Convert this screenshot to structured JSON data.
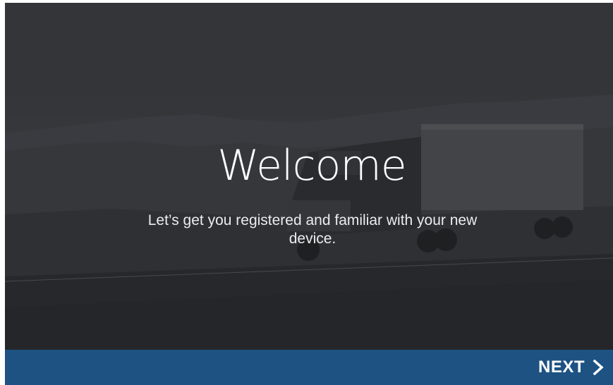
{
  "welcome": {
    "title": "Welcome",
    "subtitle": "Let’s get you registered and familiar with your new device."
  },
  "footer": {
    "next_label": "NEXT",
    "next_icon": "chevron-right-icon"
  },
  "colors": {
    "footer_bg": "#1d5282",
    "text": "#ffffff"
  }
}
